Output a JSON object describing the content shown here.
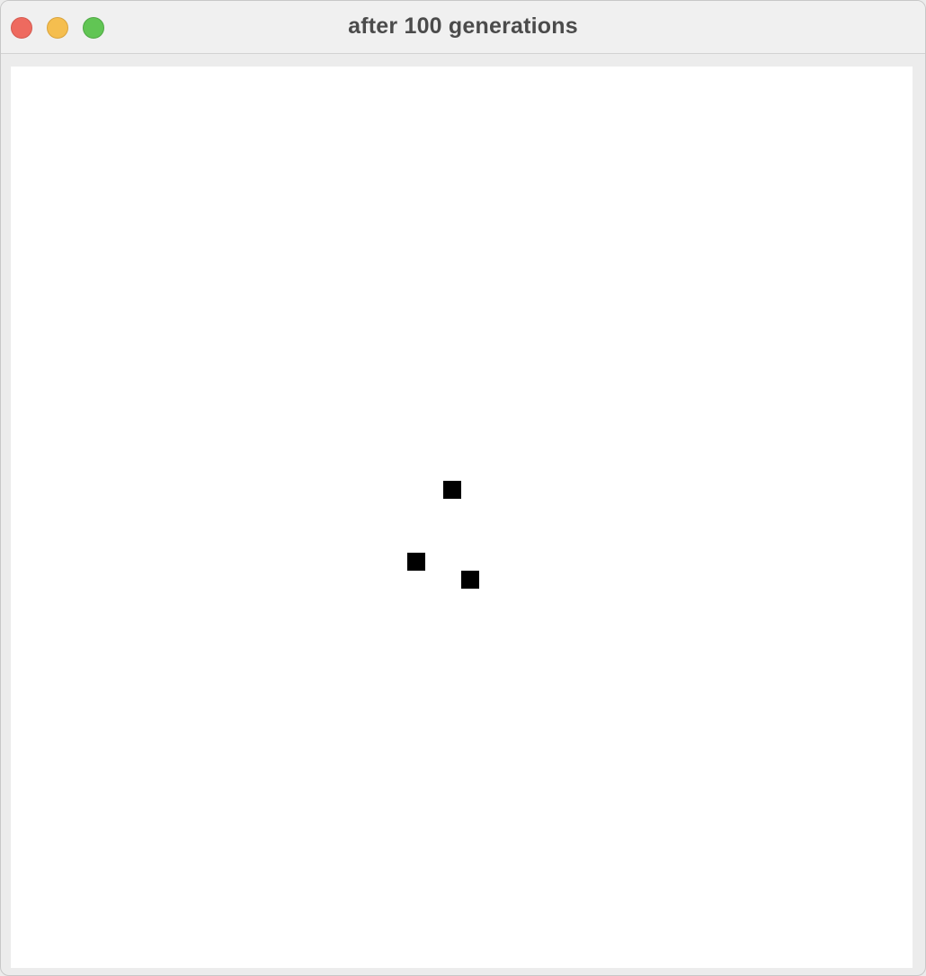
{
  "window": {
    "title": "after 100 generations"
  },
  "colors": {
    "close": "#ee6a5f",
    "minimize": "#f5be4f",
    "zoom": "#61c554",
    "live_cell": "#000000",
    "background": "#ffffff"
  },
  "icons": {
    "close": "close-button-icon",
    "minimize": "minimize-button-icon",
    "zoom": "zoom-button-icon"
  },
  "grid": {
    "live_cells": [
      {
        "col": 24,
        "row": 23
      },
      {
        "col": 22,
        "row": 27
      },
      {
        "col": 25,
        "row": 28
      }
    ]
  }
}
